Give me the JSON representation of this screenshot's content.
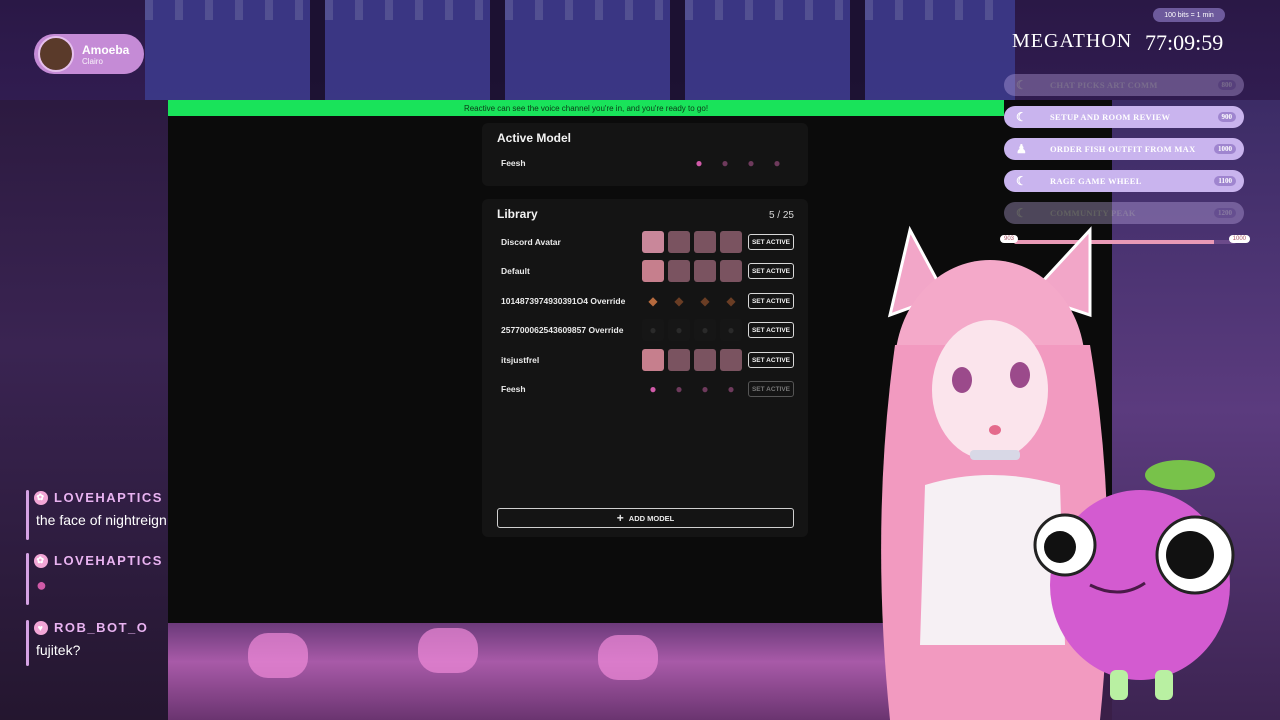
{
  "status_bar": {
    "text": "Reactive can see the voice channel you're in, and you're ready to go!"
  },
  "active_model": {
    "title": "Active Model",
    "name": "Feesh"
  },
  "library": {
    "title": "Library",
    "count": "5 / 25",
    "items": [
      {
        "name": "Discord Avatar",
        "button": "SET ACTIVE",
        "thumb_style": "pink"
      },
      {
        "name": "Default",
        "button": "SET ACTIVE",
        "thumb_style": "cat"
      },
      {
        "name": "1014873974930391O4 Override",
        "button": "SET ACTIVE",
        "thumb_style": "brown"
      },
      {
        "name": "257700062543609857 Override",
        "button": "SET ACTIVE",
        "thumb_style": "dark"
      },
      {
        "name": "itsjustfrel",
        "button": "SET ACTIVE",
        "thumb_style": "cat"
      },
      {
        "name": "Feesh",
        "button": "SET ACTIVE",
        "thumb_style": "blob",
        "disabled": true
      }
    ],
    "add_button": "ADD MODEL"
  },
  "now_playing": {
    "song": "Amoeba",
    "artist": "Clairo"
  },
  "megathon": {
    "tag": "100 bits = 1 min",
    "title": "MEGATHON",
    "timer": "77:09:59",
    "goals": [
      {
        "label": "CHAT PICKS ART COMM",
        "value": "800",
        "icon": "moon",
        "faded": true
      },
      {
        "label": "SETUP AND ROOM REVIEW",
        "value": "900",
        "icon": "moon",
        "faded": false
      },
      {
        "label": "ORDER FISH OUTFIT FROM MAX",
        "value": "1000",
        "icon": "person",
        "faded": false
      },
      {
        "label": "RAGE GAME WHEEL",
        "value": "1100",
        "icon": "moon",
        "faded": false
      },
      {
        "label": "COMMUNITY PEAK",
        "value": "1200",
        "icon": "moon",
        "faded": true
      }
    ],
    "progress": {
      "start": "903",
      "end": "1000",
      "fraction": 0.9
    }
  },
  "chat": [
    {
      "user": "LOVEHAPTICS",
      "message": "the face of nightreign"
    },
    {
      "user": "LOVEHAPTICS",
      "message": ""
    },
    {
      "user": "ROB_BOT_O",
      "message": "fujitek?"
    }
  ],
  "colors": {
    "accent_green": "#19e35a",
    "chat_name": "#e9b3f1",
    "pink": "#d05aa8"
  }
}
